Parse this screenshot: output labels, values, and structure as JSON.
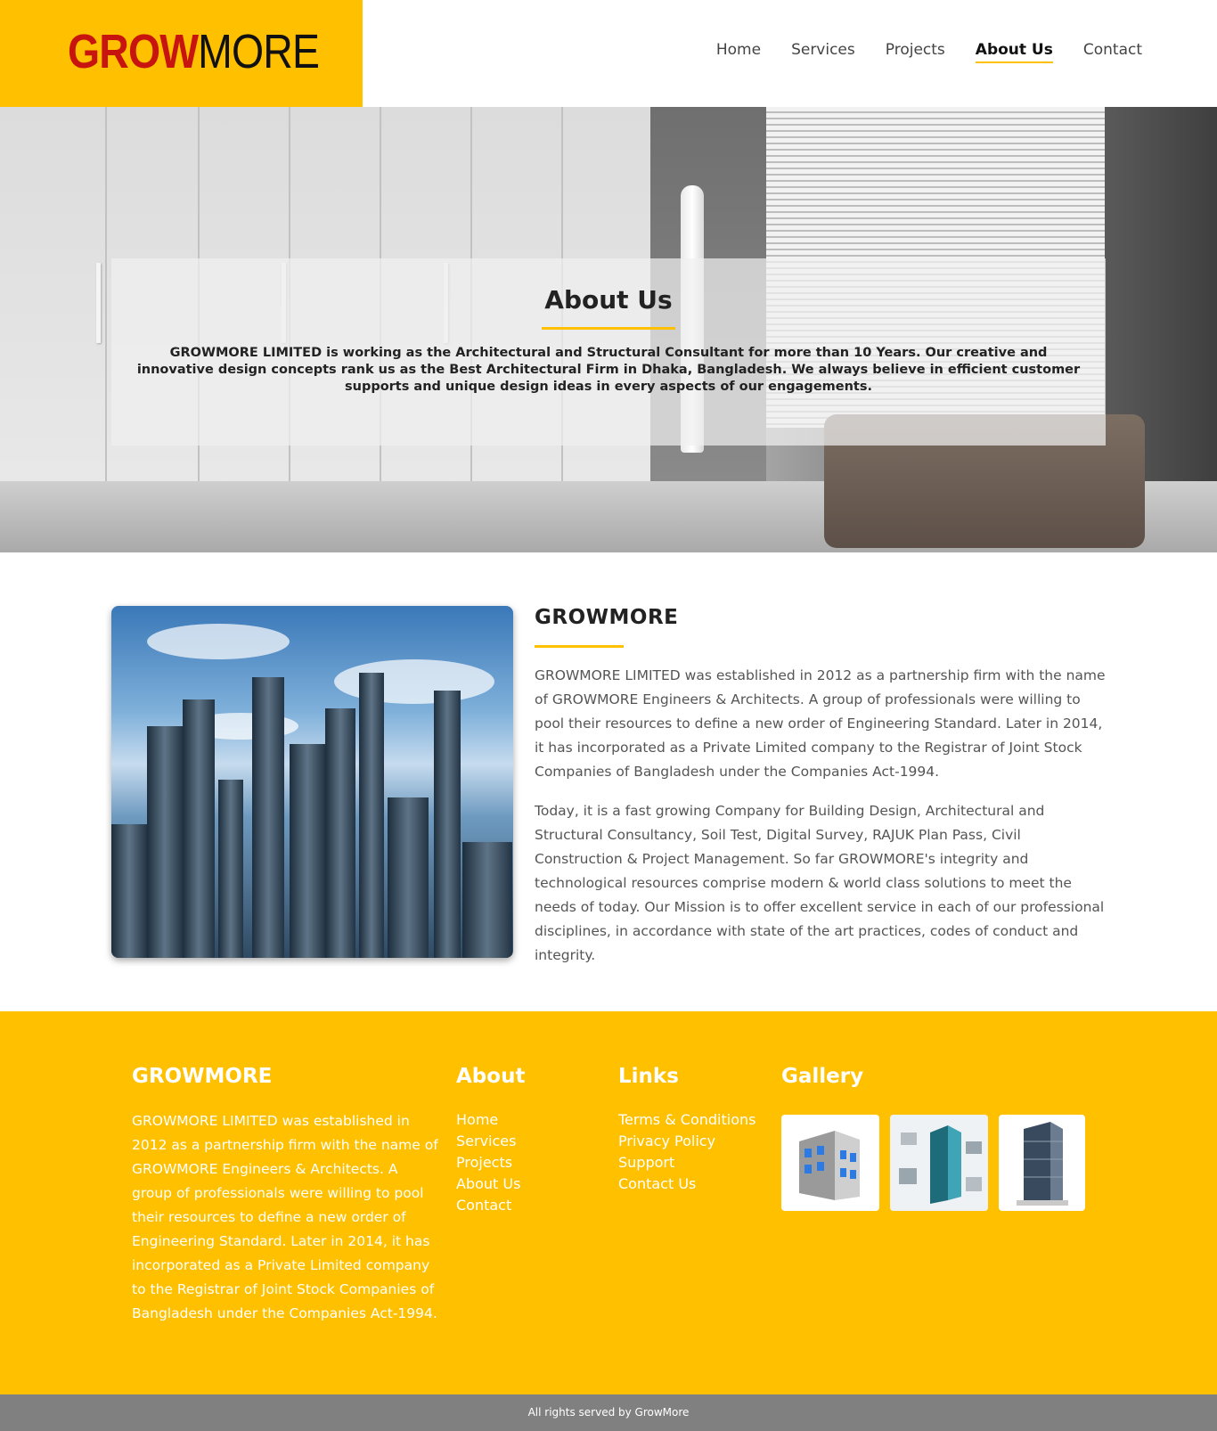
{
  "brand": {
    "part1": "GROW",
    "part2": "MORE",
    "accent_color": "#ffc000",
    "logo_red": "#c8140f"
  },
  "nav": [
    {
      "label": "Home"
    },
    {
      "label": "Services"
    },
    {
      "label": "Projects"
    },
    {
      "label": "About Us",
      "active": true
    },
    {
      "label": "Contact"
    }
  ],
  "hero": {
    "title": "About Us",
    "text": "GROWMORE LIMITED is working as the Architectural and Structural Consultant for more than 10 Years. Our creative and innovative design concepts rank us as the Best Architectural Firm in Dhaka, Bangladesh. We always believe in efficient customer supports and unique design ideas in every aspects of our engagements."
  },
  "about": {
    "heading": "GROWMORE",
    "paragraph1": "GROWMORE LIMITED was established in 2012 as a partnership firm with the name of GROWMORE Engineers & Architects. A group of professionals were willing to pool their resources to define a new order of Engineering Standard. Later in 2014, it has incorporated as a Private Limited company to the Registrar of Joint Stock Companies of Bangladesh under the Companies Act-1994.",
    "paragraph2": "Today, it is a fast growing Company for Building Design, Architectural and Structural Consultancy, Soil Test, Digital Survey, RAJUK Plan Pass, Civil Construction & Project Management. So far GROWMORE's integrity and technological resources comprise modern & world class solutions to meet the needs of today. Our Mission is to offer excellent service in each of our professional disciplines, in accordance with state of the art practices, codes of conduct and integrity."
  },
  "footer": {
    "brand_heading": "GROWMORE",
    "brand_text": "GROWMORE LIMITED was established in 2012 as a partnership firm with the name of GROWMORE Engineers & Architects. A group of professionals were willing to pool their resources to define a new order of Engineering Standard. Later in 2014, it has incorporated as a Private Limited company to the Registrar of Joint Stock Companies of Bangladesh under the Companies Act-1994.",
    "about_heading": "About",
    "about_links": [
      "Home",
      "Services",
      "Projects",
      "About Us",
      "Contact"
    ],
    "links_heading": "Links",
    "links": [
      "Terms & Conditions",
      "Privacy Policy",
      "Support",
      "Contact Us"
    ],
    "gallery_heading": "Gallery"
  },
  "copyright": "All rights served by GrowMore"
}
